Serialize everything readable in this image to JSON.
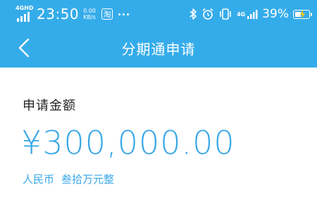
{
  "status_bar": {
    "network_tag_left": "4GHD",
    "time": "23:50",
    "speed_value": "0.00",
    "speed_unit": "KB/s",
    "notification_app": "淘",
    "network_tag_right": "4G",
    "battery_percent": "39%",
    "battery_level": 0.39,
    "icons": [
      "signal-icon",
      "taobao-notification-icon",
      "more-dots-icon",
      "bluetooth-icon",
      "alarm-icon",
      "vibrate-icon",
      "signal-icon",
      "battery-charging-icon"
    ]
  },
  "nav": {
    "title": "分期通申请",
    "back_icon": "chevron-left-icon"
  },
  "application": {
    "amount_label": "申请金额",
    "amount_value": "¥300,000.00",
    "currency": "人民币",
    "amount_in_words": "叁拾万元整"
  },
  "colors": {
    "header_bg": "#35acea",
    "amount_text": "#3aa8e6",
    "page_bg": "#ffffff"
  }
}
